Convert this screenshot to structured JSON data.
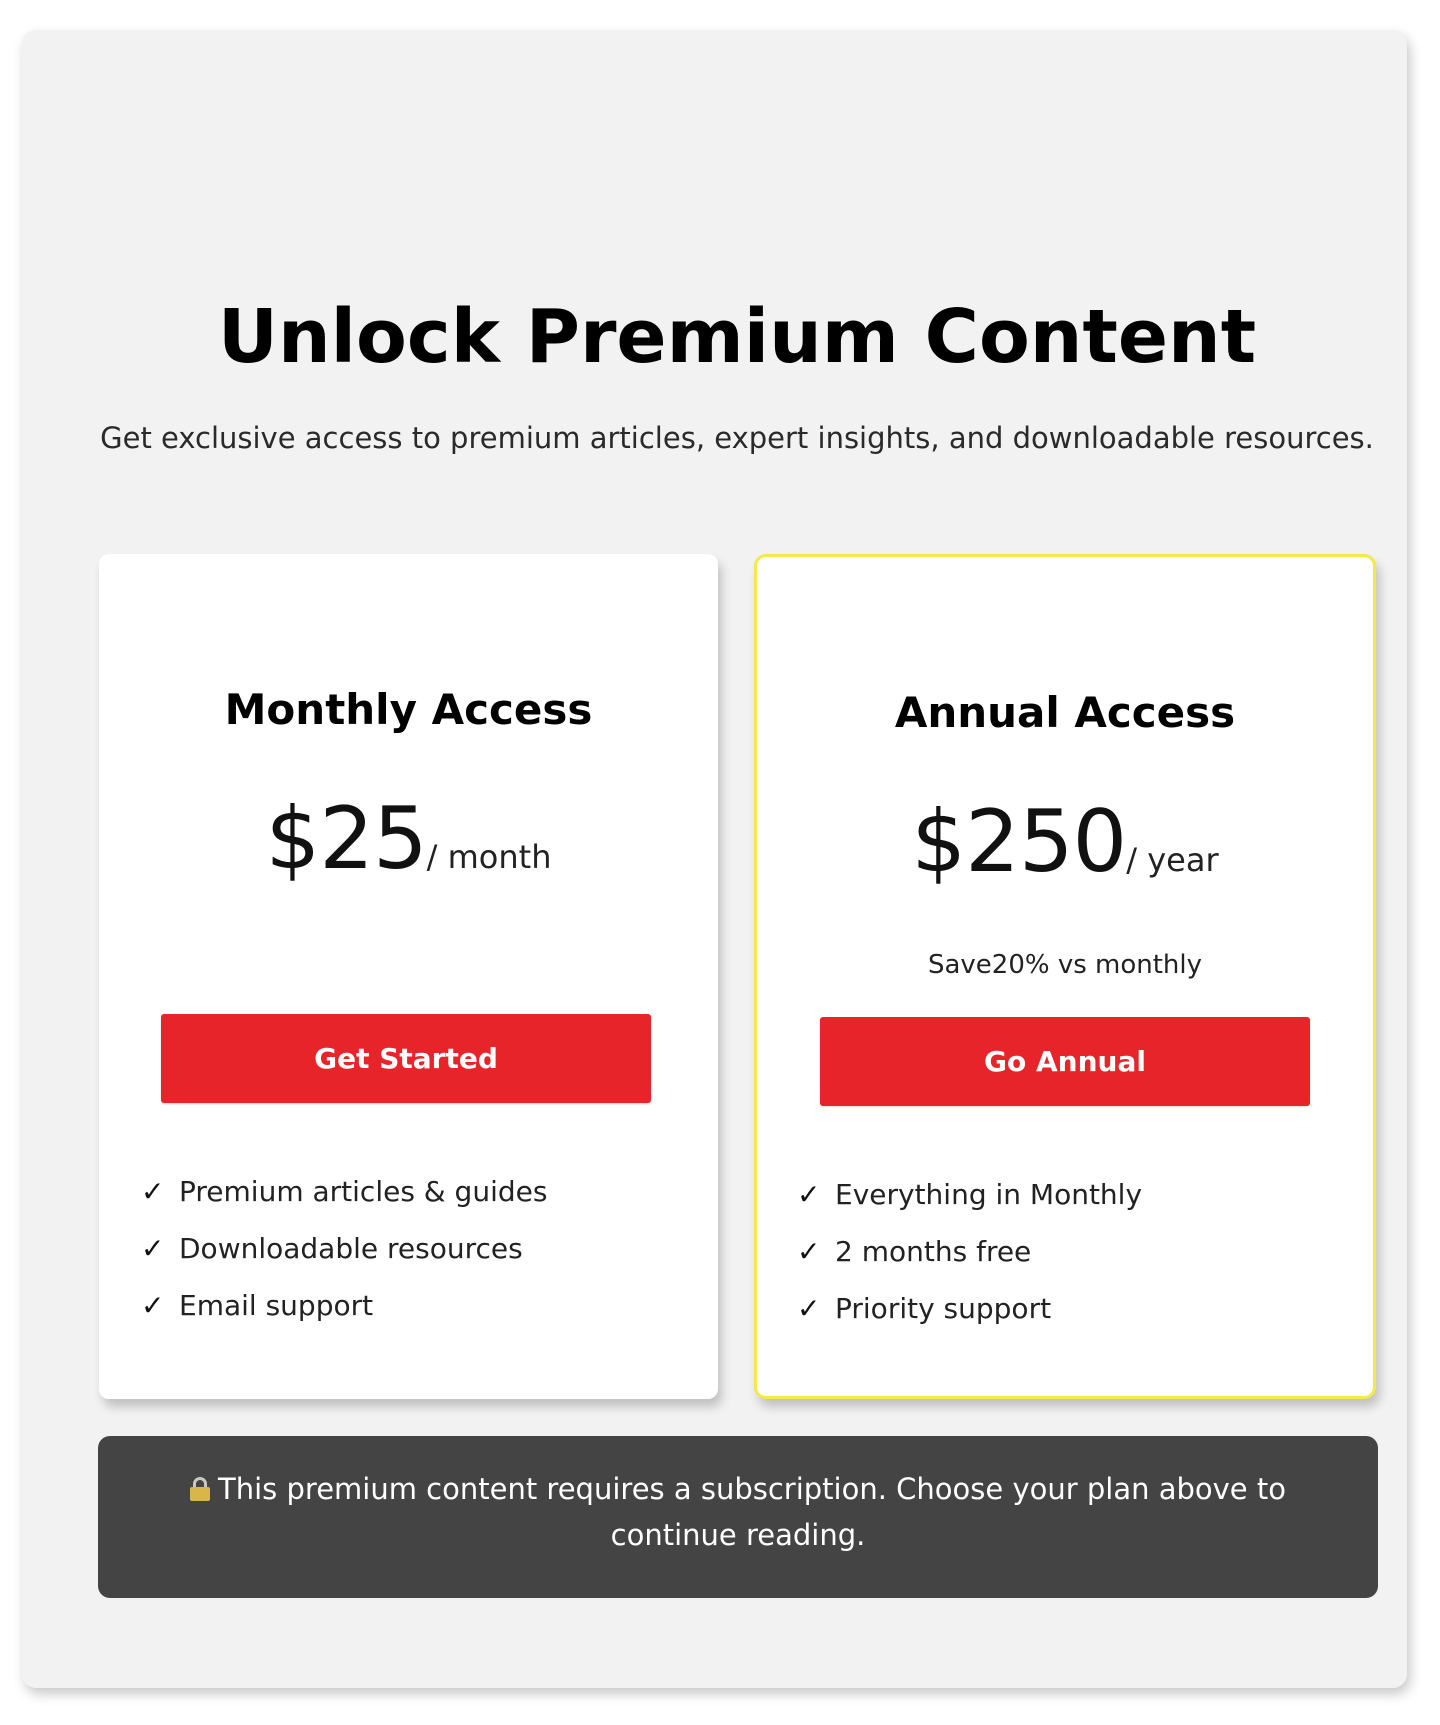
{
  "header": {
    "title": "Unlock Premium Content",
    "subtitle": "Get exclusive access to premium articles, expert insights, and downloadable resources."
  },
  "plans": [
    {
      "name": "Monthly Access",
      "price": "$25",
      "period": "/ month",
      "note": "",
      "cta_label": "Get Started",
      "features": [
        "Premium articles & guides",
        "Downloadable resources",
        "Email support"
      ]
    },
    {
      "name": "Annual Access",
      "price": "$250",
      "period": "/ year",
      "note": "Save20% vs monthly",
      "cta_label": "Go Annual",
      "features": [
        "Everything in Monthly",
        "2 months free",
        "Priority support"
      ],
      "highlight_color": "#f5e94a"
    }
  ],
  "check_glyph": "✓",
  "notice": {
    "icon": "lock-icon",
    "text": "This premium content requires a subscription. Choose your plan above to continue reading."
  },
  "colors": {
    "accent": "#e8242b",
    "notice_bg": "#444444",
    "panel_bg": "#f2f2f2"
  }
}
